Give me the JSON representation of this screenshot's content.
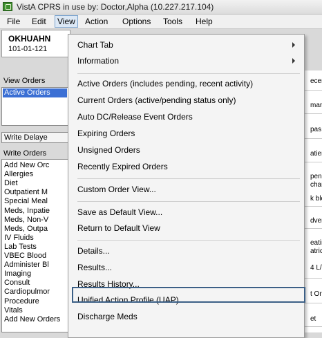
{
  "window": {
    "title": "VistA CPRS in use by: Doctor,Alpha  (10.227.217.104)"
  },
  "menubar": {
    "file": "File",
    "edit": "Edit",
    "view": "View",
    "action": "Action",
    "options": "Options",
    "tools": "Tools",
    "help": "Help"
  },
  "patient": {
    "name": "OKHUAHN",
    "id": "101-01-121"
  },
  "left": {
    "view_orders_label": "View Orders",
    "active_orders": "Active Orders",
    "write_delayed_button": "Write Delaye",
    "write_orders_label": "Write Orders",
    "orders": [
      "Add New Orc",
      "Allergies",
      "Diet",
      "Outpatient M",
      "Special Meal",
      "Meds, Inpatie",
      "Meds, Non-V",
      "Meds, Outpa",
      "IV Fluids",
      "Lab Tests",
      "VBEC Blood",
      "Administer Bl",
      "Imaging",
      "Consult",
      "Cardiopulmor",
      "Procedure",
      "Vitals",
      "Add New Orders"
    ]
  },
  "right_panel": {
    "texts": [
      "ecen",
      "mane",
      "pas:",
      "atient",
      "pen a",
      "chang",
      "k blo",
      "dver",
      "eating",
      "atrick",
      "4 L/",
      "t Orc",
      "et"
    ]
  },
  "view_menu": {
    "items": [
      {
        "label": "Chart Tab",
        "submenu": true
      },
      {
        "label": "Information",
        "submenu": true
      },
      {
        "label": "Active Orders (includes pending, recent activity)"
      },
      {
        "label": "Current Orders (active/pending status only)"
      },
      {
        "label": "Auto DC/Release Event Orders"
      },
      {
        "label": "Expiring Orders"
      },
      {
        "label": "Unsigned Orders"
      },
      {
        "label": "Recently Expired Orders"
      },
      {
        "label": "Custom Order View..."
      },
      {
        "label": "Save as Default View..."
      },
      {
        "label": "Return to Default View"
      },
      {
        "label": "Details..."
      },
      {
        "label": "Results..."
      },
      {
        "label": "Results History..."
      },
      {
        "label": "Unified Action Profile (UAP)",
        "highlighted": true
      },
      {
        "label": "Discharge Meds"
      }
    ]
  }
}
